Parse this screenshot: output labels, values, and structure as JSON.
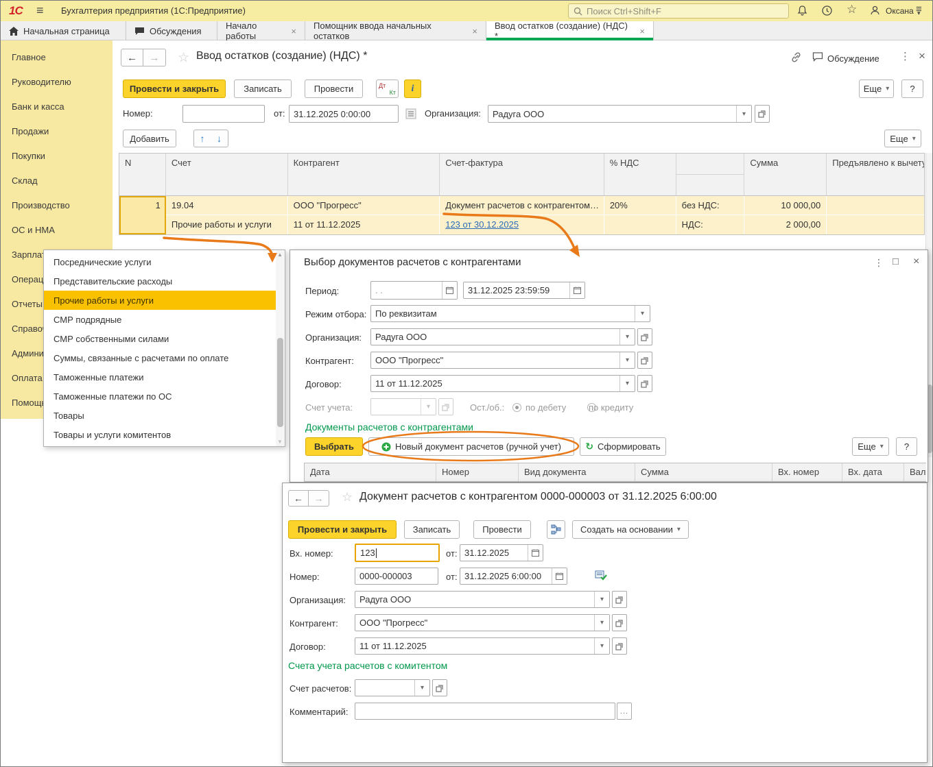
{
  "colors": {
    "titlebar_bg": "#f6eca2",
    "sidebar_bg": "#f8e9a2",
    "yellow_button": "#fcd32b",
    "tab_underline_green": "#00a651",
    "section_green": "#00984b",
    "row_bg": "#fcf1cb",
    "selected_item": "#fac100",
    "link_blue": "#2b6cb8",
    "annotation_orange": "#e87a1a",
    "focus_border": "#e8a400"
  },
  "icons": {
    "hamburger": "≡",
    "close": "×",
    "kebab": "⋮",
    "caret_down": "▾",
    "back": "←",
    "forward": "→",
    "star": "☆",
    "up_arrow": "↑",
    "down_arrow": "↓",
    "refresh": "↻",
    "maximize": "□",
    "scroll_up": "▲",
    "scroll_down": "▼",
    "ellipsis": "...",
    "info": "i",
    "dt": "Дт",
    "kt": "Кт",
    "plus": "+"
  },
  "titlebar": {
    "logo": "1С",
    "title": "Бухгалтерия предприятия  (1С:Предприятие)",
    "search_placeholder": "Поиск Ctrl+Shift+F",
    "user": "Оксана"
  },
  "tabs": {
    "items": [
      "Начальная страница",
      "Обсуждения",
      "Начало работы",
      "Помощник ввода начальных остатков",
      "Ввод остатков (создание) (НДС) *"
    ]
  },
  "sidebar": {
    "items": [
      "Главное",
      "Руководителю",
      "Банк и касса",
      "Продажи",
      "Покупки",
      "Склад",
      "Производство",
      "ОС и НМА",
      "Зарплата и кадры",
      "Операции",
      "Отчеты",
      "Справочники",
      "Администрирование",
      "Оплата",
      "Помощь"
    ]
  },
  "doc": {
    "title": "Ввод остатков (создание) (НДС) *",
    "discussion_label": "Обсуждение",
    "btn_post_close": "Провести и закрыть",
    "btn_save": "Записать",
    "btn_post": "Провести",
    "btn_more": "Еще",
    "btn_help": "?",
    "btn_add": "Добавить",
    "num_label": "Номер:",
    "from_label": "от:",
    "date_value": "31.12.2025  0:00:00",
    "org_label": "Организация:",
    "org_value": "Радуга ООО",
    "table": {
      "cols": [
        "N",
        "Счет",
        "Контрагент",
        "Счет-фактура",
        "% НДС",
        "",
        "Сумма",
        "Предъявлено к вычету"
      ],
      "row": {
        "n": "1",
        "account": "19.04",
        "account_detail": "Прочие работы и услуги",
        "contractor": "ООО \"Прогресс\"",
        "contract": "11 от 11.12.2025",
        "doc_ref": "Документ расчетов с контрагентом…",
        "invoice_link": "123 от 30.12.2025",
        "vat": "20%",
        "wo_vat_label": "без НДС:",
        "wo_vat": "10 000,00",
        "vat_label": "НДС:",
        "vat_sum": "2 000,00"
      }
    }
  },
  "dropdown": {
    "items": [
      "Посреднические услуги",
      "Представительские расходы",
      "Прочие работы и услуги",
      "СМР подрядные",
      "СМР собственными силами",
      "Суммы, связанные с расчетами по оплате",
      "Таможенные платежи",
      "Таможенные платежи по ОС",
      "Товары",
      "Товары и услуги комитентов"
    ],
    "selected_index": 2
  },
  "dialog": {
    "title": "Выбор документов расчетов с контрагентами",
    "period_label": "Период:",
    "period_from": ". .",
    "period_to": "31.12.2025 23:59:59",
    "mode_label": "Режим отбора:",
    "mode_value": "По реквизитам",
    "org_label": "Организация:",
    "org_value": "Радуга ООО",
    "contractor_label": "Контрагент:",
    "contractor_value": "ООО \"Прогресс\"",
    "contract_label": "Договор:",
    "contract_value": "11 от 11.12.2025",
    "account_label": "Счет учета:",
    "balance_label": "Ост./об.:",
    "radio_debit": "по дебету",
    "radio_credit": "по кредиту",
    "section_title": "Документы расчетов с контрагентами",
    "btn_select": "Выбрать",
    "btn_new": "Новый документ расчетов (ручной учет)",
    "btn_generate": "Сформировать",
    "btn_more": "Еще",
    "btn_help": "?",
    "cols": [
      "Дата",
      "Номер",
      "Вид документа",
      "Сумма",
      "Вх. номер",
      "Вх. дата",
      "Валюта"
    ]
  },
  "calc": {
    "title": "Документ расчетов с контрагентом 0000-000003 от 31.12.2025 6:00:00",
    "btn_post_close": "Провести и закрыть",
    "btn_save": "Записать",
    "btn_post": "Провести",
    "btn_create_from": "Создать на основании",
    "in_num_label": "Вх. номер:",
    "in_num": "123",
    "from_label": "от:",
    "in_date": "31.12.2025",
    "num_label": "Номер:",
    "num": "0000-000003",
    "date": "31.12.2025  6:00:00",
    "org_label": "Организация:",
    "org": "Радуга ООО",
    "contractor_label": "Контрагент:",
    "contractor": "ООО \"Прогресс\"",
    "contract_label": "Договор:",
    "contract": "11 от 11.12.2025",
    "section_title": "Счета учета расчетов с комитентом",
    "account_label": "Счет расчетов:",
    "comment_label": "Комментарий:"
  }
}
